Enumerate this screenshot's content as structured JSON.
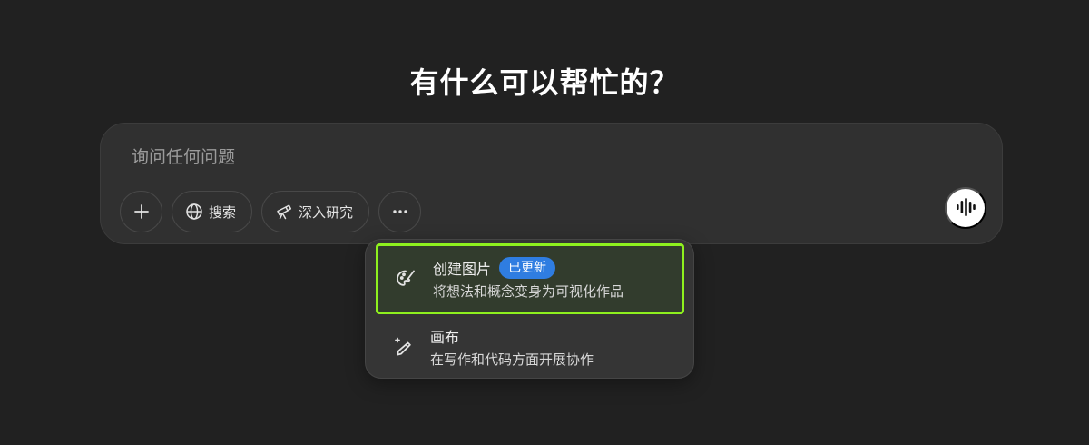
{
  "headline": "有什么可以帮忙的？",
  "composer": {
    "placeholder": "询问任何问题",
    "search_label": "搜索",
    "deep_research_label": "深入研究"
  },
  "menu": {
    "items": [
      {
        "title": "创建图片",
        "badge": "已更新",
        "description": "将想法和概念变身为可视化作品"
      },
      {
        "title": "画布",
        "description": "在写作和代码方面开展协作"
      }
    ]
  },
  "colors": {
    "background": "#212121",
    "composer": "#303030",
    "menu": "#353535",
    "badge": "#2f7de1",
    "highlight_border": "#8ef01e"
  },
  "icons": [
    "plus-icon",
    "globe-icon",
    "telescope-icon",
    "more-icon",
    "voice-mode-icon",
    "paint-palette-icon",
    "pen-sparkle-icon"
  ]
}
